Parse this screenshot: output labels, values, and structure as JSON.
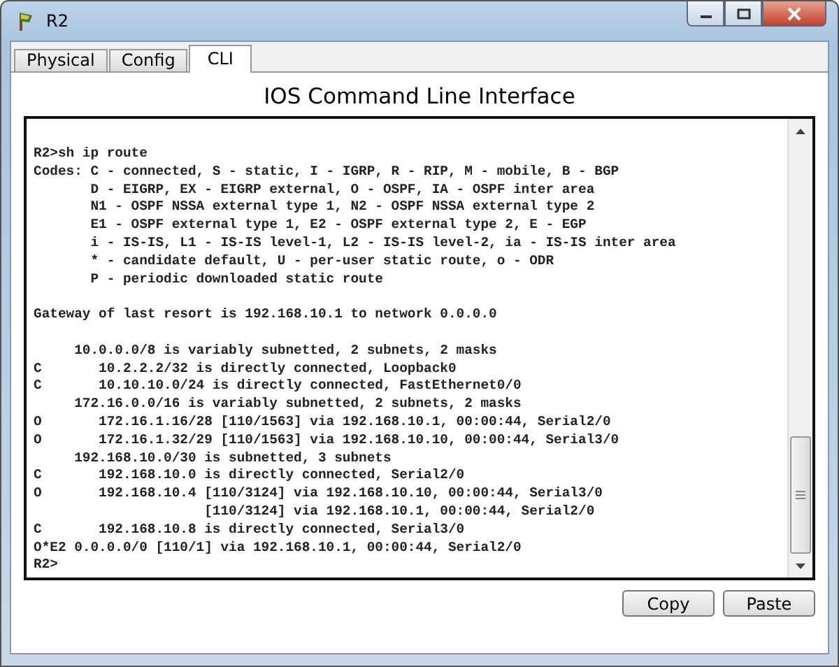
{
  "window": {
    "title": "R2"
  },
  "tabs": [
    {
      "label": "Physical",
      "selected": false
    },
    {
      "label": "Config",
      "selected": false
    },
    {
      "label": "CLI",
      "selected": true
    }
  ],
  "heading": "IOS Command Line Interface",
  "terminal": {
    "blocks": [
      [
        "R2>sh ip route",
        "Codes: C - connected, S - static, I - IGRP, R - RIP, M - mobile, B - BGP",
        "       D - EIGRP, EX - EIGRP external, O - OSPF, IA - OSPF inter area",
        "       N1 - OSPF NSSA external type 1, N2 - OSPF NSSA external type 2",
        "       E1 - OSPF external type 1, E2 - OSPF external type 2, E - EGP",
        "       i - IS-IS, L1 - IS-IS level-1, L2 - IS-IS level-2, ia - IS-IS inter area",
        "       * - candidate default, U - per-user static route, o - ODR",
        "       P - periodic downloaded static route"
      ],
      [
        "Gateway of last resort is 192.168.10.1 to network 0.0.0.0"
      ],
      [
        "     10.0.0.0/8 is variably subnetted, 2 subnets, 2 masks",
        "C       10.2.2.2/32 is directly connected, Loopback0",
        "C       10.10.10.0/24 is directly connected, FastEthernet0/0",
        "     172.16.0.0/16 is variably subnetted, 2 subnets, 2 masks",
        "O       172.16.1.16/28 [110/1563] via 192.168.10.1, 00:00:44, Serial2/0",
        "O       172.16.1.32/29 [110/1563] via 192.168.10.10, 00:00:44, Serial3/0",
        "     192.168.10.0/30 is subnetted, 3 subnets",
        "C       192.168.10.0 is directly connected, Serial2/0",
        "O       192.168.10.4 [110/3124] via 192.168.10.10, 00:00:44, Serial3/0",
        "                     [110/3124] via 192.168.10.1, 00:00:44, Serial2/0",
        "C       192.168.10.8 is directly connected, Serial3/0",
        "O*E2 0.0.0.0/0 [110/1] via 192.168.10.1, 00:00:44, Serial2/0",
        "R2>"
      ]
    ]
  },
  "buttons": [
    "Copy",
    "Paste"
  ]
}
